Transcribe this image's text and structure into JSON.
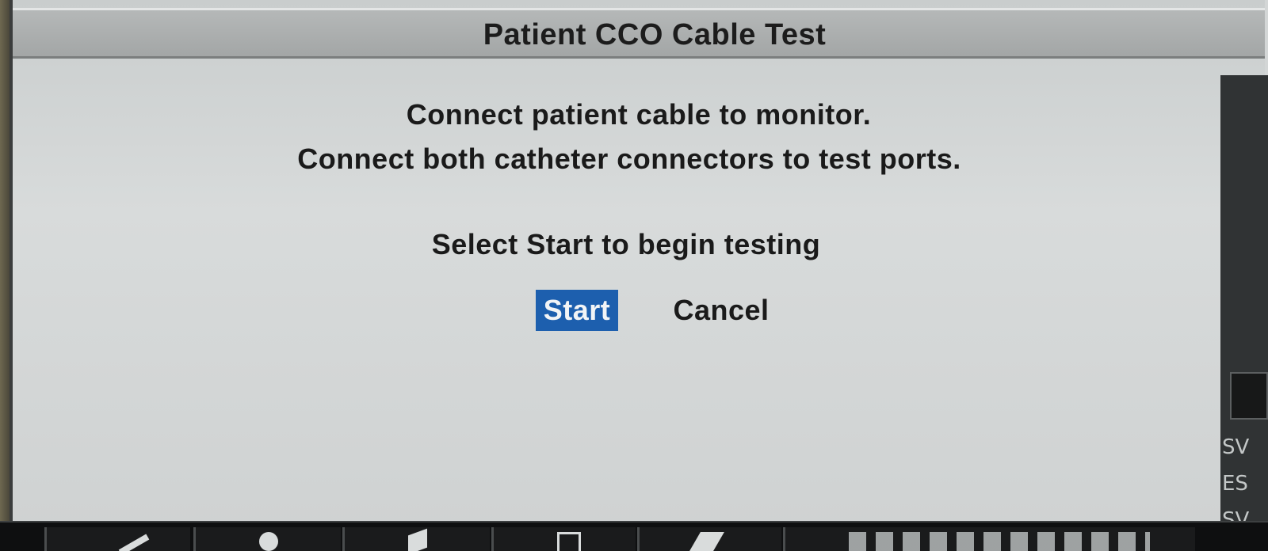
{
  "dialog": {
    "title": "Patient CCO Cable Test",
    "instruction_lines": [
      "Connect patient cable to monitor.",
      "Connect both catheter connectors to test ports."
    ],
    "prompt": "Select Start to begin testing"
  },
  "buttons": {
    "start_label": "Start",
    "cancel_label": "Cancel"
  },
  "side_panel": {
    "labels": [
      "SV",
      "ES",
      "SV"
    ]
  },
  "bottom_bar": {
    "icons": [
      "pencil-icon",
      "person-icon",
      "pointer-icon",
      "clipboard-icon",
      "printer-icon"
    ]
  },
  "colors": {
    "selected_button": "#1d5fae",
    "dialog_background": "#d3d6d6",
    "title_bar": "#a9acac"
  }
}
